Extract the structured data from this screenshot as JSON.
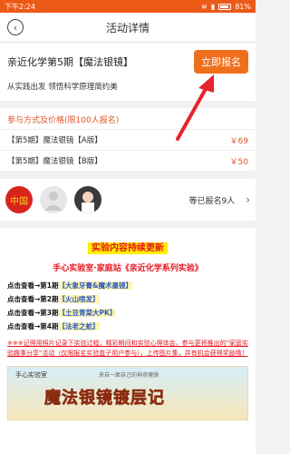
{
  "status": {
    "time": "下午2:24",
    "battery": "81%"
  },
  "nav": {
    "title": "活动详情"
  },
  "activity": {
    "title": "亲近化学第5期【魔法银镜】",
    "signup_label": "立即报名",
    "subtitle": "从实践出发 领悟科学原理简约美"
  },
  "pricing": {
    "header": "参与方式及价格(限100人报名)",
    "items": [
      {
        "name": "【第5期】魔法银镜【A版】",
        "price": "￥69"
      },
      {
        "name": "【第5期】魔法银镜【B版】",
        "price": "￥50"
      }
    ]
  },
  "attendees": {
    "summary": "等已报名9人",
    "avatar1_text": "中国"
  },
  "content": {
    "banner": "实验内容持续更新",
    "subhead": "手心实验室·家庭站《亲近化学系列实验》",
    "links": [
      {
        "prefix": "点击查看→第1期",
        "title": "【大象牙膏&魔术墨镜】"
      },
      {
        "prefix": "点击查看→第2期",
        "title": "【火山喷发】"
      },
      {
        "prefix": "点击查看→第3期",
        "title": "【土豆青菜大PK】"
      },
      {
        "prefix": "点击查看→第4期",
        "title": "【法老之蛇】"
      }
    ],
    "notice": "※※※记得用照片记录下实验过程，精彩瞬间和实验心得体会，参与更将推出的\"家庭实验趣事分享\"活动（仅限报名实验盒子用户参与），上传图片集，并有机会获得奖励哦！",
    "poster_logo": "手心实验室",
    "poster_top": "来自一面自己的神奇魔镜",
    "poster_title": "魔法银镜镀层记"
  }
}
